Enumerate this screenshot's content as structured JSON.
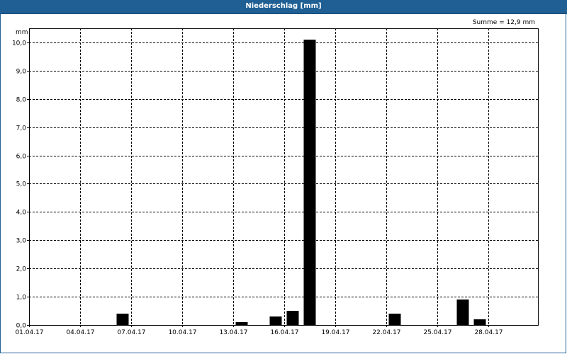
{
  "window": {
    "title": "Niederschlag [mm]"
  },
  "chart_data": {
    "type": "bar",
    "unit_label": "mm",
    "summary": "Summe = 12,9 mm",
    "ylim": [
      0,
      10.5
    ],
    "y_ticks": [
      0,
      1,
      2,
      3,
      4,
      5,
      6,
      7,
      8,
      9,
      10
    ],
    "y_tick_labels": [
      "0,0",
      "1,0",
      "2,0",
      "3,0",
      "4,0",
      "5,0",
      "6,0",
      "7,0",
      "8,0",
      "9,0",
      "10,0"
    ],
    "x_tick_labels": [
      "01.04.17",
      "04.04.17",
      "07.04.17",
      "10.04.17",
      "13.04.17",
      "16.04.17",
      "19.04.17",
      "22.04.17",
      "25.04.17",
      "28.04.17"
    ],
    "x_tick_days": [
      1,
      4,
      7,
      10,
      13,
      16,
      19,
      22,
      25,
      28
    ],
    "x_range_days": [
      1,
      31
    ],
    "grid": true,
    "bar_color": "#000000",
    "bars": [
      {
        "day": 7,
        "date": "06.04.17",
        "value": 0.4
      },
      {
        "day": 14,
        "date": "13.04.17",
        "value": 0.1
      },
      {
        "day": 16,
        "date": "15.04.17",
        "value": 0.3
      },
      {
        "day": 17,
        "date": "16.04.17",
        "value": 0.5
      },
      {
        "day": 18,
        "date": "17.04.17",
        "value": 10.1
      },
      {
        "day": 23,
        "date": "22.04.17",
        "value": 0.4
      },
      {
        "day": 27,
        "date": "26.04.17",
        "value": 0.9
      },
      {
        "day": 28,
        "date": "27.04.17",
        "value": 0.2
      }
    ]
  }
}
